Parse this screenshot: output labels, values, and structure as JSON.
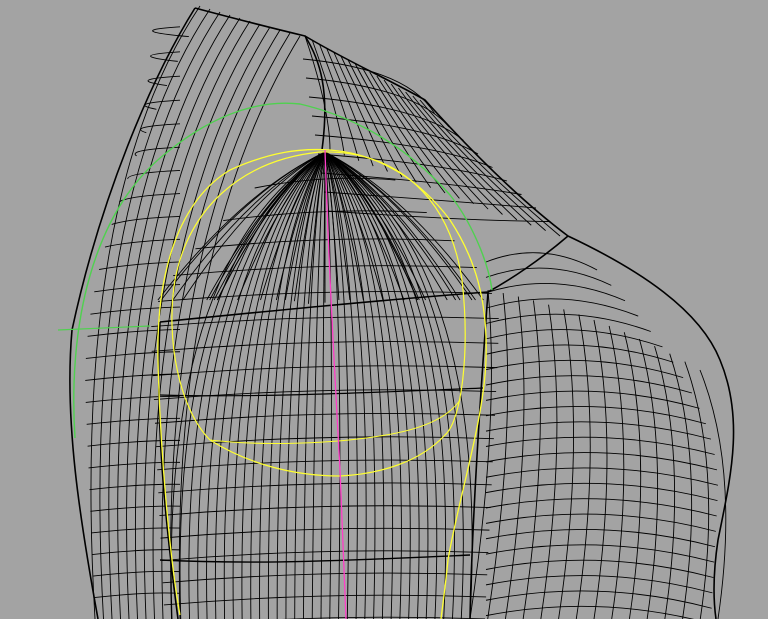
{
  "viewport": {
    "background": "#a3a3a3",
    "mesh_color": "#000000",
    "curve_colors": {
      "green": "#4fd14f",
      "yellow": "#ffff30",
      "magenta": "#ff3ec8"
    }
  }
}
